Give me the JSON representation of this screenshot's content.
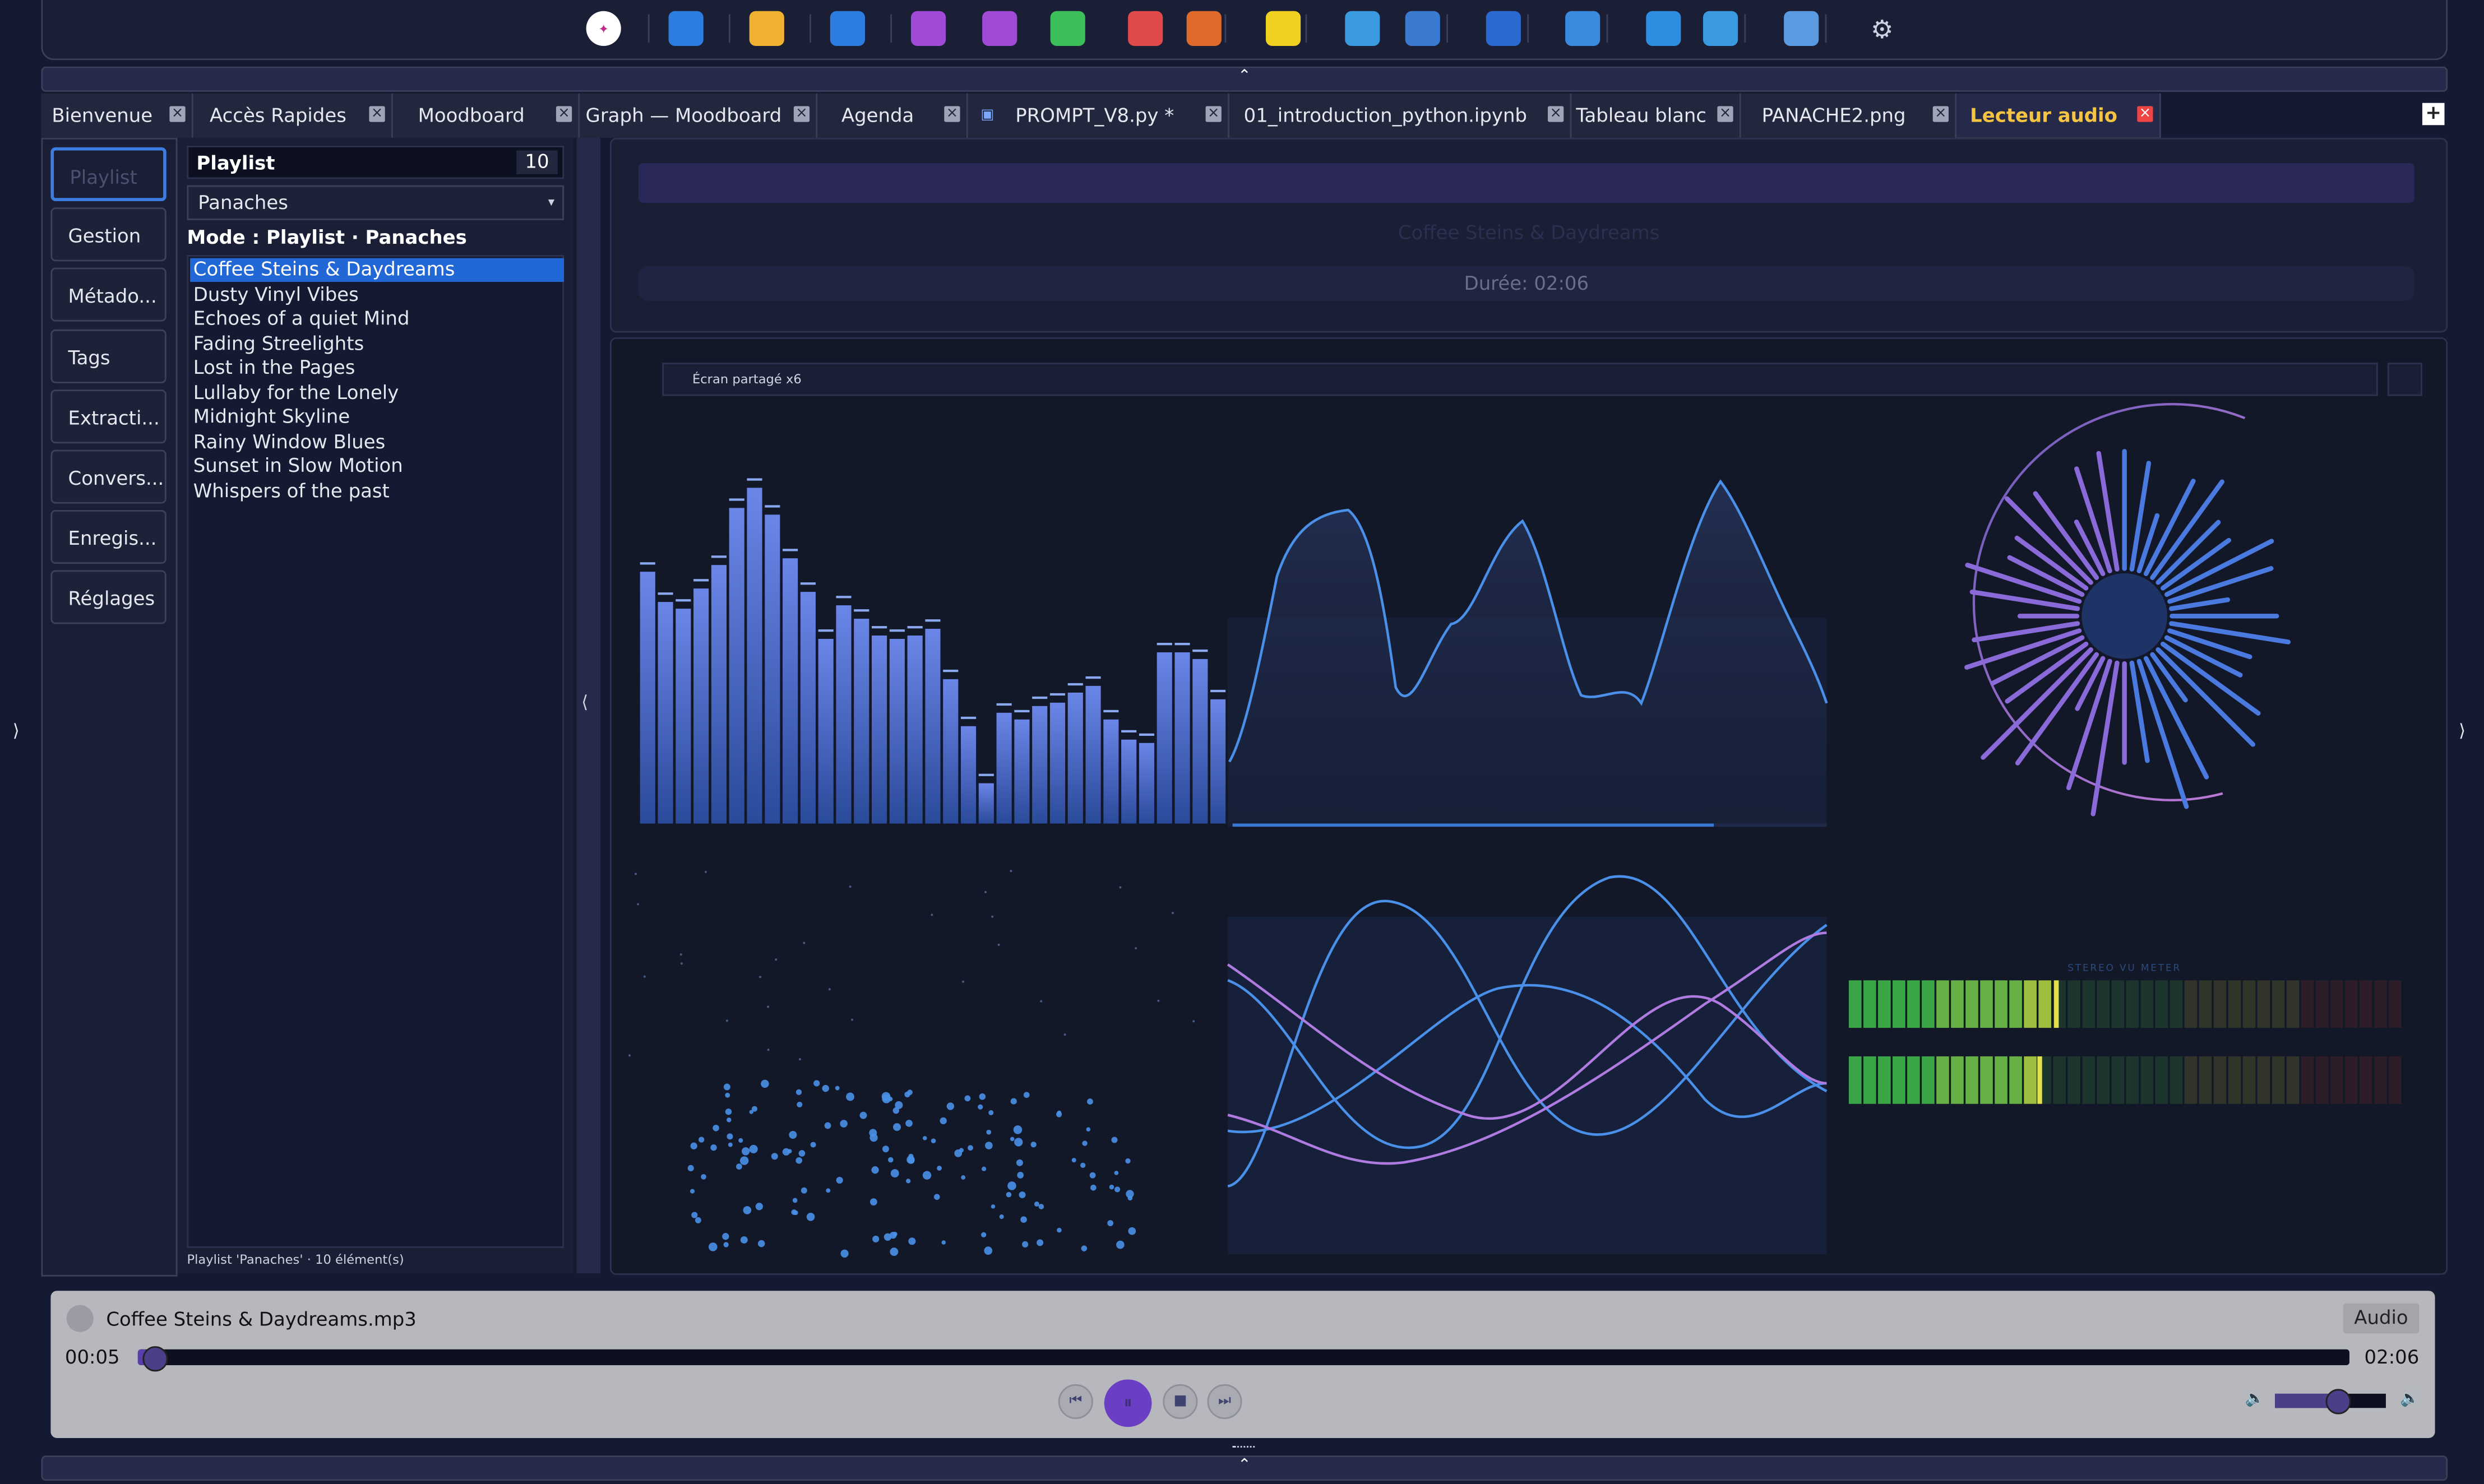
{
  "launcher": {
    "icons": [
      "app-logo-icon",
      "window-icon",
      "folder-icon",
      "calendar-icon",
      "note-icon",
      "doc-icon",
      "sheet-icon",
      "pdf-icon",
      "epub-icon",
      "sticky-note-icon",
      "code-icon",
      "python-icon",
      "whiteboard-icon",
      "image-icon",
      "music-icon",
      "video-icon",
      "file-manager-icon",
      "settings-icon"
    ]
  },
  "tabs": [
    {
      "label": "Bienvenue"
    },
    {
      "label": "Accès Rapides"
    },
    {
      "label": "Moodboard"
    },
    {
      "label": "Graph — Moodboard"
    },
    {
      "label": "Agenda"
    },
    {
      "label": "PROMPT_V8.py *"
    },
    {
      "label": "01_introduction_python.ipynb"
    },
    {
      "label": "Tableau blanc"
    },
    {
      "label": "PANACHE2.png"
    },
    {
      "label": "Lecteur audio"
    }
  ],
  "nav": {
    "items": [
      "Playlist",
      "Gestion",
      "Métado...",
      "Tags",
      "Extracti...",
      "Convers...",
      "Enregis...",
      "Réglages"
    ]
  },
  "playlist": {
    "title": "Playlist",
    "count": "10",
    "selected": "Panaches",
    "mode": "Mode : Playlist · Panaches",
    "tracks": [
      "Coffee Steins & Daydreams",
      "Dusty Vinyl Vibes",
      "Echoes of a quiet Mind",
      "Fading Streelights",
      "Lost in the Pages",
      "Lullaby for the Lonely",
      "Midnight Skyline",
      "Rainy Window Blues",
      "Sunset in Slow Motion",
      "Whispers of the past"
    ],
    "footer": "Playlist 'Panaches' · 10 élément(s)"
  },
  "info": {
    "title": "Coffee Steins & Daydreams",
    "duration": "Durée: 02:06"
  },
  "viz": {
    "mode": "Écran partagé x6",
    "vu_label": "STEREO VU METER",
    "spectrum_levels": [
      0.75,
      0.66,
      0.64,
      0.7,
      0.77,
      0.94,
      1.0,
      0.92,
      0.79,
      0.69,
      0.55,
      0.65,
      0.61,
      0.56,
      0.55,
      0.56,
      0.58,
      0.43,
      0.29,
      0.12,
      0.33,
      0.31,
      0.35,
      0.36,
      0.39,
      0.41,
      0.31,
      0.25,
      0.24,
      0.51,
      0.51,
      0.49,
      0.37
    ],
    "progress": 0.04,
    "vu_left": 0.37,
    "vu_right": 0.34,
    "colors": {
      "blue": "#4a90e8",
      "purple": "#b07be0",
      "green": "#4caf50",
      "yellow": "#d8d040"
    }
  },
  "player": {
    "file": "Coffee Steins & Daydreams.mp3",
    "badge": "Audio",
    "current": "00:05",
    "total": "02:06",
    "progress": 0.004,
    "volume": 0.55
  }
}
